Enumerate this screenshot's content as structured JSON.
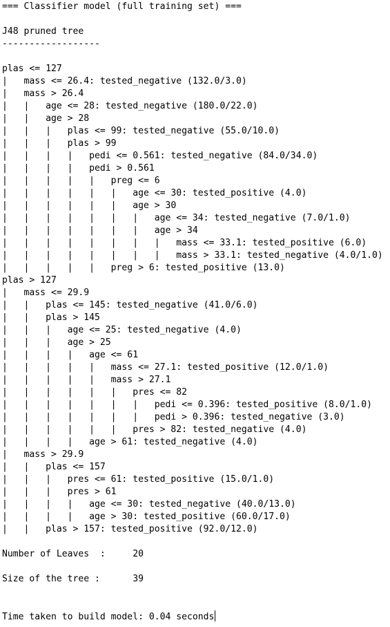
{
  "output": {
    "lines": [
      "=== Classifier model (full training set) ===",
      "",
      "J48 pruned tree",
      "------------------",
      "",
      "plas <= 127",
      "|   mass <= 26.4: tested_negative (132.0/3.0)",
      "|   mass > 26.4",
      "|   |   age <= 28: tested_negative (180.0/22.0)",
      "|   |   age > 28",
      "|   |   |   plas <= 99: tested_negative (55.0/10.0)",
      "|   |   |   plas > 99",
      "|   |   |   |   pedi <= 0.561: tested_negative (84.0/34.0)",
      "|   |   |   |   pedi > 0.561",
      "|   |   |   |   |   preg <= 6",
      "|   |   |   |   |   |   age <= 30: tested_positive (4.0)",
      "|   |   |   |   |   |   age > 30",
      "|   |   |   |   |   |   |   age <= 34: tested_negative (7.0/1.0)",
      "|   |   |   |   |   |   |   age > 34",
      "|   |   |   |   |   |   |   |   mass <= 33.1: tested_positive (6.0)",
      "|   |   |   |   |   |   |   |   mass > 33.1: tested_negative (4.0/1.0)",
      "|   |   |   |   |   preg > 6: tested_positive (13.0)",
      "plas > 127",
      "|   mass <= 29.9",
      "|   |   plas <= 145: tested_negative (41.0/6.0)",
      "|   |   plas > 145",
      "|   |   |   age <= 25: tested_negative (4.0)",
      "|   |   |   age > 25",
      "|   |   |   |   age <= 61",
      "|   |   |   |   |   mass <= 27.1: tested_positive (12.0/1.0)",
      "|   |   |   |   |   mass > 27.1",
      "|   |   |   |   |   |   pres <= 82",
      "|   |   |   |   |   |   |   pedi <= 0.396: tested_positive (8.0/1.0)",
      "|   |   |   |   |   |   |   pedi > 0.396: tested_negative (3.0)",
      "|   |   |   |   |   |   pres > 82: tested_negative (4.0)",
      "|   |   |   |   age > 61: tested_negative (4.0)",
      "|   mass > 29.9",
      "|   |   plas <= 157",
      "|   |   |   pres <= 61: tested_positive (15.0/1.0)",
      "|   |   |   pres > 61",
      "|   |   |   |   age <= 30: tested_negative (40.0/13.0)",
      "|   |   |   |   age > 30: tested_positive (60.0/17.0)",
      "|   |   plas > 157: tested_positive (92.0/12.0)",
      "",
      "Number of Leaves  : \t20",
      "",
      "Size of the tree : \t39",
      "",
      "",
      "Time taken to build model: 0.04 seconds"
    ]
  }
}
